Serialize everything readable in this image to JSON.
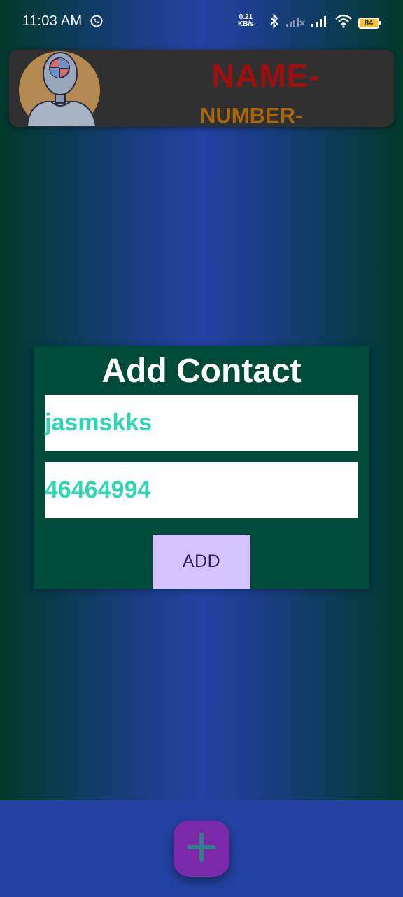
{
  "status_bar": {
    "time": "11:03 AM",
    "net_speed_value": "0.21",
    "net_speed_unit": "KB/s",
    "battery": "84",
    "icons": [
      "whatsapp-icon",
      "bluetooth-icon",
      "signal-icon-1",
      "signal-icon-2",
      "wifi-icon",
      "battery-icon"
    ]
  },
  "header": {
    "name_label": "NAME-",
    "number_label": "NUMBER-",
    "name_color": "#a10e0e",
    "number_color": "#a8660a",
    "avatar_icon": "robot-avatar-icon"
  },
  "dialog": {
    "title": "Add Contact",
    "name_value": "jasmskks",
    "number_value": "46464994",
    "add_label": "ADD",
    "background": "#004a3a",
    "field_text_color": "#2fd6b6",
    "button_color": "#d4c3ff"
  },
  "fab": {
    "icon": "plus-icon",
    "color": "#7a2aa8"
  }
}
